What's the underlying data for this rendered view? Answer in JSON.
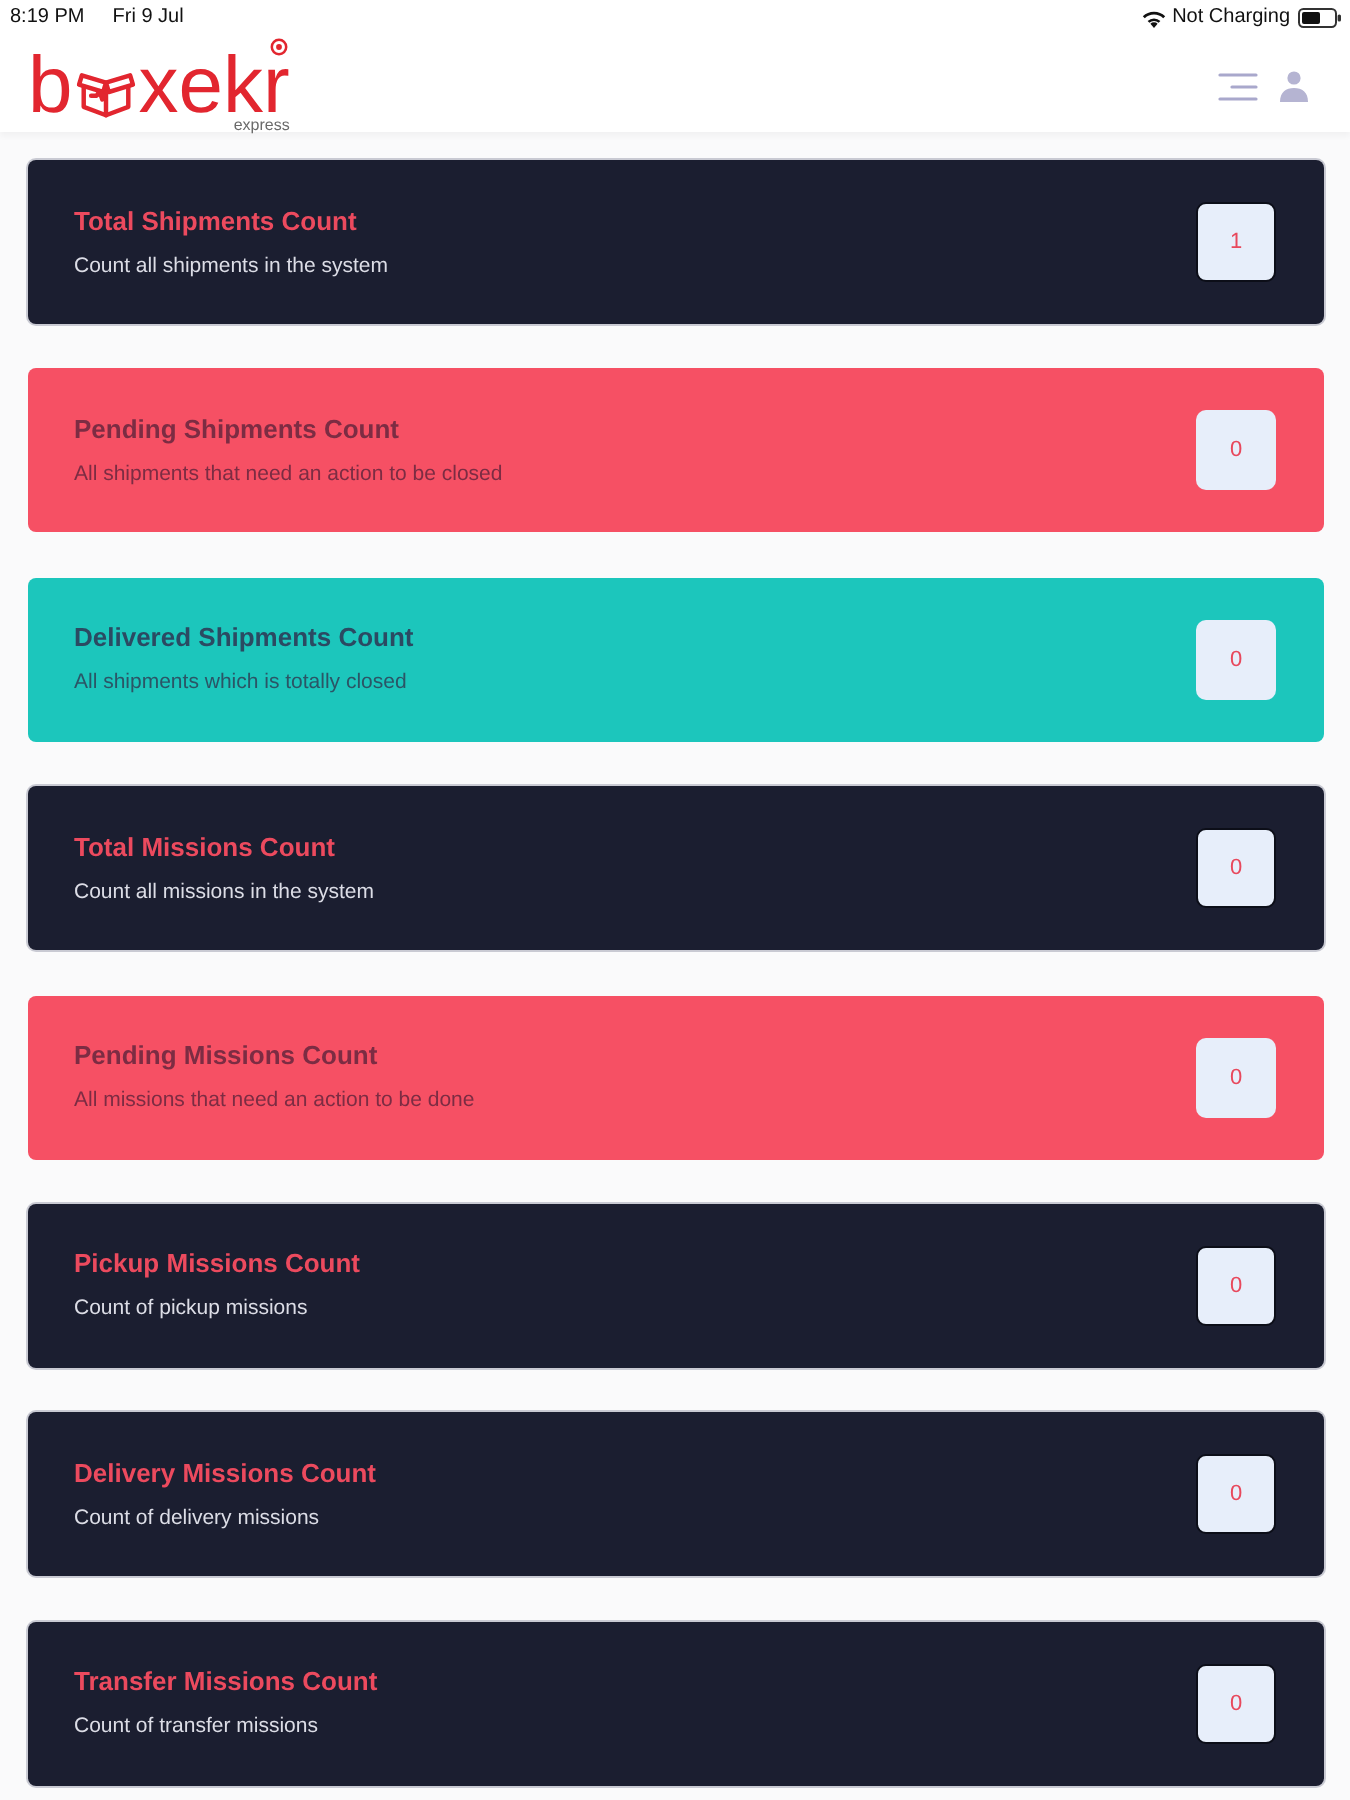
{
  "status_bar": {
    "time": "8:19 PM",
    "date": "Fri 9 Jul",
    "charging": "Not Charging"
  },
  "header": {
    "logo": {
      "lead": "b",
      "trail": "xekr",
      "tagline": "express"
    }
  },
  "cards": [
    {
      "kind": "neutral",
      "title": "Total Shipments Count",
      "description": "Count all shipments in the system",
      "count": "1"
    },
    {
      "kind": "warning",
      "title": "Pending Shipments Count",
      "description": "All shipments that need an action to be closed",
      "count": "0"
    },
    {
      "kind": "success",
      "title": "Delivered Shipments Count",
      "description": "All shipments which is totally closed",
      "count": "0"
    },
    {
      "kind": "neutral",
      "title": "Total Missions Count",
      "description": "Count all missions in the system",
      "count": "0"
    },
    {
      "kind": "warning",
      "title": "Pending Missions Count",
      "description": "All missions that need an action to be done",
      "count": "0"
    },
    {
      "kind": "neutral",
      "title": "Pickup Missions Count",
      "description": "Count of pickup missions",
      "count": "0"
    },
    {
      "kind": "neutral",
      "title": "Delivery Missions Count",
      "description": "Count of delivery missions",
      "count": "0"
    },
    {
      "kind": "neutral",
      "title": "Transfer Missions Count",
      "description": "Count of transfer missions",
      "count": "0"
    }
  ]
}
